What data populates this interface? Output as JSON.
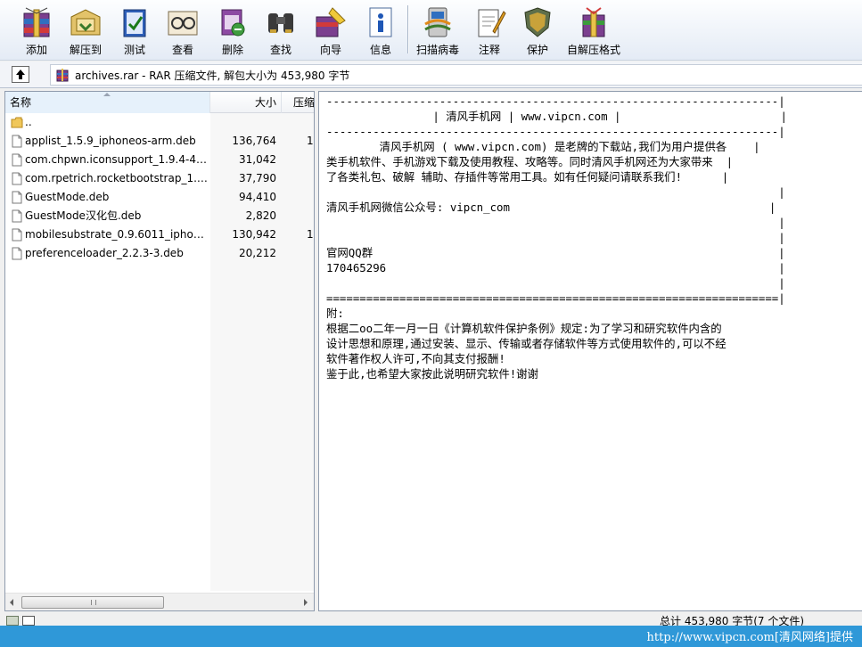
{
  "toolbar": {
    "buttons": [
      {
        "label": "添加",
        "icon": "add-archive-icon"
      },
      {
        "label": "解压到",
        "icon": "extract-to-icon"
      },
      {
        "label": "测试",
        "icon": "test-icon"
      },
      {
        "label": "查看",
        "icon": "view-icon"
      },
      {
        "label": "删除",
        "icon": "delete-icon"
      },
      {
        "label": "查找",
        "icon": "find-icon"
      },
      {
        "label": "向导",
        "icon": "wizard-icon"
      },
      {
        "label": "信息",
        "icon": "info-icon"
      },
      {
        "label": "扫描病毒",
        "icon": "virus-scan-icon"
      },
      {
        "label": "注释",
        "icon": "comment-icon"
      },
      {
        "label": "保护",
        "icon": "protect-icon"
      },
      {
        "label": "自解压格式",
        "icon": "sfx-icon"
      }
    ]
  },
  "address": {
    "text": "archives.rar - RAR 压缩文件, 解包大小为 453,980 字节"
  },
  "filelist": {
    "columns": {
      "name": "名称",
      "size": "大小",
      "compressed": "压缩"
    },
    "rows": [
      {
        "name": "..",
        "size": "",
        "comp": "",
        "type": "folder"
      },
      {
        "name": "applist_1.5.9_iphoneos-arm.deb",
        "size": "136,764",
        "comp": "1",
        "type": "file"
      },
      {
        "name": "com.chpwn.iconsupport_1.9.4-4_i...",
        "size": "31,042",
        "comp": "",
        "type": "file"
      },
      {
        "name": "com.rpetrich.rocketbootstrap_1.0....",
        "size": "37,790",
        "comp": "",
        "type": "file"
      },
      {
        "name": "GuestMode.deb",
        "size": "94,410",
        "comp": "",
        "type": "file"
      },
      {
        "name": "GuestMode汉化包.deb",
        "size": "2,820",
        "comp": "",
        "type": "file"
      },
      {
        "name": "mobilesubstrate_0.9.6011_iphone...",
        "size": "130,942",
        "comp": "1",
        "type": "file"
      },
      {
        "name": "preferenceloader_2.2.3-3.deb",
        "size": "20,212",
        "comp": "",
        "type": "file"
      }
    ]
  },
  "comment": {
    "lines": [
      "--------------------------------------------------------------------|",
      "                | 清风手机网 | www.vipcn.com |                        |",
      "--------------------------------------------------------------------|",
      "        清风手机网 ( www.vipcn.com) 是老牌的下载站,我们为用户提供各    |",
      "类手机软件、手机游戏下载及使用教程、攻略等。同时清风手机网还为大家带来  |",
      "了各类礼包、破解 辅助、存插件等常用工具。如有任何疑问请联系我们!      |",
      "                                                                    |",
      "清风手机网微信公众号: vipcn_com                                       |",
      "                                                                    |",
      "                                                                    |",
      "官网QQ群                                                             |",
      "170465296                                                           |",
      "                                                                    |",
      "====================================================================|",
      "附:",
      "根据二oo二年一月一日《计算机软件保护条例》规定:为了学习和研究软件内含的",
      "设计思想和原理,通过安装、显示、传输或者存储软件等方式使用软件的,可以不经",
      "软件著作权人许可,不向其支付报酬!",
      "鉴于此,也希望大家按此说明研究软件!谢谢"
    ]
  },
  "status": {
    "text": "总计 453,980 字节(7 个文件)"
  },
  "watermark": {
    "text": "http://www.vipcn.com[清风网络]提供"
  }
}
